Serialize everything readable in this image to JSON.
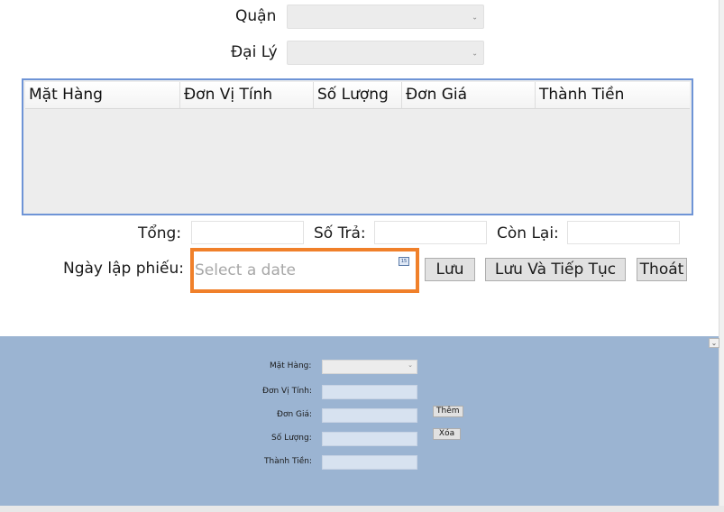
{
  "filters": {
    "quan_label": "Quận",
    "dai_ly_label": "Đại Lý"
  },
  "grid": {
    "columns": [
      "Mặt Hàng",
      "Đơn Vị Tính",
      "Số Lượng",
      "Đơn Giá",
      "Thành Tiền"
    ]
  },
  "totals": {
    "tong_label": "Tổng:",
    "so_tra_label": "Số Trả:",
    "con_lai_label": "Còn Lại:"
  },
  "date": {
    "label": "Ngày lập phiếu:",
    "placeholder": "Select a date"
  },
  "actions": {
    "luu": "Lưu",
    "luu_tiep_tuc": "Lưu Và Tiếp Tục",
    "thoat": "Thoát"
  },
  "panel": {
    "mat_hang_label": "Mặt Hàng:",
    "don_vi_tinh_label": "Đơn Vị Tính:",
    "don_gia_label": "Đơn Giá:",
    "so_luong_label": "Số Lượng:",
    "thanh_tien_label": "Thành Tiền:",
    "them_button": "Thêm",
    "xoa_button": "Xóa",
    "background_color": "#9bb4d2"
  },
  "colors": {
    "grid_border": "#6e94d6",
    "date_highlight": "#f0802a"
  }
}
